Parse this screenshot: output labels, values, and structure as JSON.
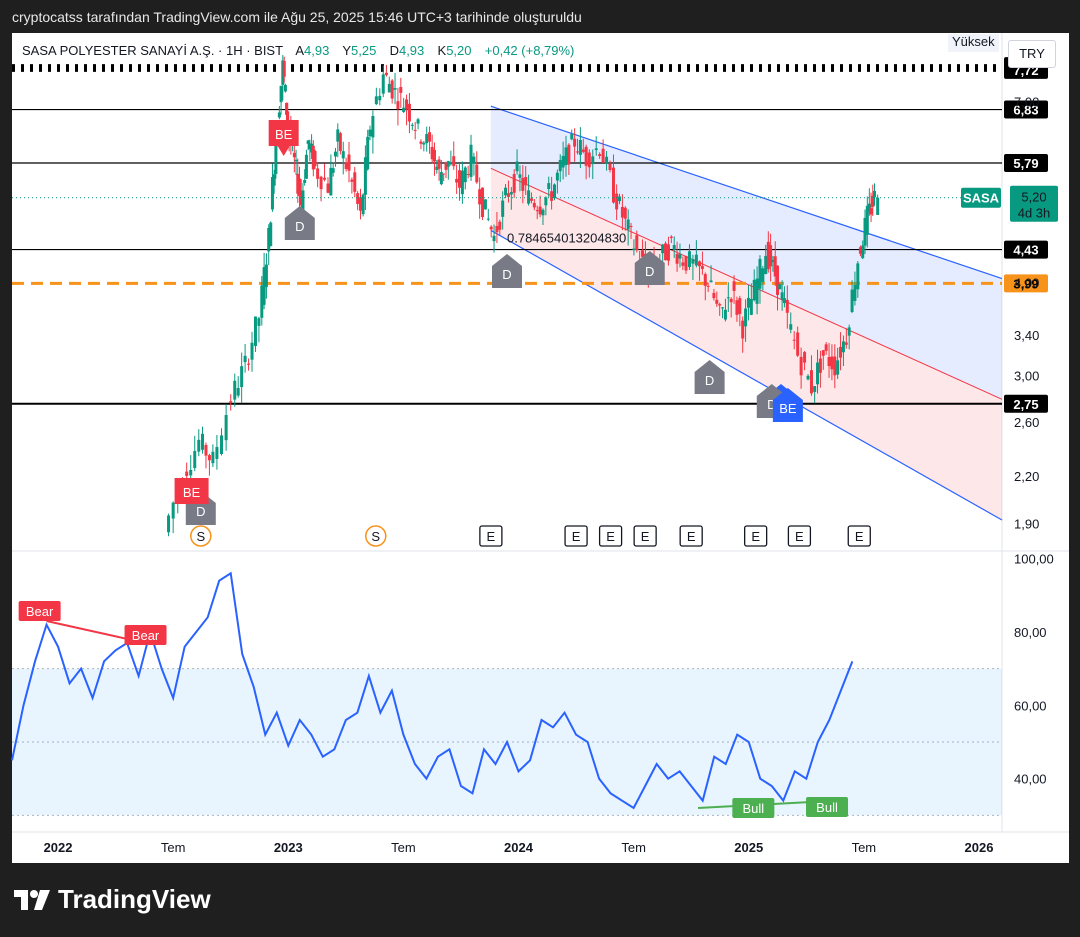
{
  "caption": "cryptocatss tarafından TradingView.com ile Ağu 25, 2025 15:46 UTC+3 tarihinde oluşturuldu",
  "brand": "TradingView",
  "legend": {
    "symbol": "SASA POLYESTER SANAYİ A.Ş. · 1H · BIST",
    "open_label": "A",
    "open": "4,93",
    "high_label": "Y",
    "high": "5,25",
    "low_label": "D",
    "low": "4,93",
    "close_label": "K",
    "close": "5,20",
    "change": "+0,42 (+8,79%)"
  },
  "currency": "TRY",
  "scale_mode": "Yüksek",
  "colors": {
    "up": "#089981",
    "down": "#f23645",
    "rsi": "#2962ff",
    "orange": "#f7931a",
    "channel_line": "#2962ff",
    "mid_line": "#f23645"
  },
  "price_tag": {
    "symbol": "SASA",
    "price": "5,20",
    "countdown": "4d 3h"
  },
  "fib_label": "0.784654013204830",
  "events": {
    "split_label": "S",
    "earnings_label": "E",
    "dividend_label": "D",
    "be_label": "BE",
    "bear_label": "Bear",
    "bull_label": "Bull"
  },
  "chart_data": [
    {
      "type": "candlestick",
      "title": "SASA POLYESTER SANAYİ A.Ş. · 1H · BIST",
      "x_axis": {
        "ticks": [
          "2022",
          "Tem",
          "2023",
          "Tem",
          "2024",
          "Tem",
          "2025",
          "Tem",
          "2026"
        ],
        "range": [
          2021.8,
          2026.1
        ]
      },
      "y_axis": {
        "scale": "log",
        "ticks": [
          "1,90",
          "2,20",
          "2,60",
          "3,00",
          "3,40",
          "4,00",
          "7,00"
        ],
        "range": [
          1.75,
          8.6
        ]
      },
      "ohlc_last": {
        "open": 4.93,
        "high": 5.25,
        "low": 4.93,
        "close": 5.2
      },
      "price_path": [
        [
          2022.47,
          1.85
        ],
        [
          2022.55,
          2.2
        ],
        [
          2022.62,
          2.45
        ],
        [
          2022.68,
          2.3
        ],
        [
          2022.76,
          2.8
        ],
        [
          2022.82,
          3.1
        ],
        [
          2022.88,
          3.6
        ],
        [
          2022.92,
          4.6
        ],
        [
          2022.95,
          6.2
        ],
        [
          2022.98,
          7.8
        ],
        [
          2023.0,
          6.5
        ],
        [
          2023.03,
          5.8
        ],
        [
          2023.06,
          5.1
        ],
        [
          2023.09,
          6.2
        ],
        [
          2023.12,
          5.7
        ],
        [
          2023.18,
          5.4
        ],
        [
          2023.22,
          6.2
        ],
        [
          2023.27,
          5.6
        ],
        [
          2023.32,
          4.9
        ],
        [
          2023.36,
          6.5
        ],
        [
          2023.42,
          7.6
        ],
        [
          2023.47,
          7.2
        ],
        [
          2023.52,
          6.9
        ],
        [
          2023.57,
          6.4
        ],
        [
          2023.62,
          6.1
        ],
        [
          2023.66,
          5.6
        ],
        [
          2023.7,
          5.8
        ],
        [
          2023.75,
          5.4
        ],
        [
          2023.8,
          5.9
        ],
        [
          2023.85,
          5.1
        ],
        [
          2023.9,
          4.6
        ],
        [
          2023.95,
          5.2
        ],
        [
          2024.0,
          5.6
        ],
        [
          2024.05,
          5.2
        ],
        [
          2024.1,
          5.1
        ],
        [
          2024.15,
          5.3
        ],
        [
          2024.2,
          5.8
        ],
        [
          2024.25,
          6.2
        ],
        [
          2024.3,
          5.9
        ],
        [
          2024.36,
          6.1
        ],
        [
          2024.42,
          5.3
        ],
        [
          2024.47,
          4.8
        ],
        [
          2024.52,
          4.4
        ],
        [
          2024.57,
          4.1
        ],
        [
          2024.62,
          4.3
        ],
        [
          2024.67,
          4.5
        ],
        [
          2024.72,
          4.3
        ],
        [
          2024.78,
          4.2
        ],
        [
          2024.83,
          4.0
        ],
        [
          2024.88,
          3.6
        ],
        [
          2024.93,
          3.9
        ],
        [
          2024.98,
          3.5
        ],
        [
          2025.03,
          3.9
        ],
        [
          2025.08,
          4.4
        ],
        [
          2025.12,
          4.1
        ],
        [
          2025.16,
          3.7
        ],
        [
          2025.22,
          3.2
        ],
        [
          2025.28,
          2.9
        ],
        [
          2025.33,
          3.2
        ],
        [
          2025.38,
          3.1
        ],
        [
          2025.43,
          3.4
        ],
        [
          2025.48,
          4.3
        ],
        [
          2025.52,
          4.9
        ],
        [
          2025.55,
          5.2
        ]
      ],
      "horizontal_levels": [
        7.81,
        7.72,
        6.83,
        5.79,
        4.43,
        3.99,
        2.75
      ],
      "level_labels": [
        "7,81",
        "7,72",
        "6,83",
        "5,79",
        "4,43",
        "3,99",
        "2,75"
      ],
      "annotations": [
        "BE",
        "D",
        "D",
        "D",
        "D",
        "D",
        "D",
        "BE",
        "BE"
      ]
    },
    {
      "type": "line",
      "title": "",
      "y_axis": {
        "ticks": [
          "40,00",
          "60,00",
          "80,00",
          "100,00"
        ],
        "range": [
          26,
          101
        ]
      },
      "bands": [
        30,
        50,
        70
      ],
      "values": [
        [
          2021.8,
          45
        ],
        [
          2021.85,
          60
        ],
        [
          2021.9,
          72
        ],
        [
          2021.95,
          82
        ],
        [
          2022.0,
          76
        ],
        [
          2022.05,
          66
        ],
        [
          2022.1,
          70
        ],
        [
          2022.15,
          62
        ],
        [
          2022.2,
          72
        ],
        [
          2022.25,
          75
        ],
        [
          2022.3,
          77
        ],
        [
          2022.35,
          68
        ],
        [
          2022.4,
          80
        ],
        [
          2022.45,
          70
        ],
        [
          2022.5,
          62
        ],
        [
          2022.55,
          76
        ],
        [
          2022.6,
          80
        ],
        [
          2022.65,
          84
        ],
        [
          2022.7,
          94
        ],
        [
          2022.75,
          96
        ],
        [
          2022.8,
          74
        ],
        [
          2022.85,
          65
        ],
        [
          2022.9,
          52
        ],
        [
          2022.95,
          58
        ],
        [
          2023.0,
          49
        ],
        [
          2023.05,
          56
        ],
        [
          2023.1,
          52
        ],
        [
          2023.15,
          46
        ],
        [
          2023.2,
          48
        ],
        [
          2023.25,
          56
        ],
        [
          2023.3,
          58
        ],
        [
          2023.35,
          68
        ],
        [
          2023.4,
          58
        ],
        [
          2023.45,
          64
        ],
        [
          2023.5,
          52
        ],
        [
          2023.55,
          44
        ],
        [
          2023.6,
          40
        ],
        [
          2023.65,
          46
        ],
        [
          2023.7,
          48
        ],
        [
          2023.75,
          38
        ],
        [
          2023.8,
          36
        ],
        [
          2023.85,
          48
        ],
        [
          2023.9,
          44
        ],
        [
          2023.95,
          50
        ],
        [
          2024.0,
          42
        ],
        [
          2024.05,
          45
        ],
        [
          2024.1,
          56
        ],
        [
          2024.15,
          54
        ],
        [
          2024.2,
          58
        ],
        [
          2024.25,
          52
        ],
        [
          2024.3,
          50
        ],
        [
          2024.35,
          40
        ],
        [
          2024.4,
          36
        ],
        [
          2024.45,
          34
        ],
        [
          2024.5,
          32
        ],
        [
          2024.55,
          38
        ],
        [
          2024.6,
          44
        ],
        [
          2024.65,
          40
        ],
        [
          2024.7,
          42
        ],
        [
          2024.75,
          38
        ],
        [
          2024.8,
          34
        ],
        [
          2024.85,
          46
        ],
        [
          2024.9,
          44
        ],
        [
          2024.95,
          52
        ],
        [
          2025.0,
          50
        ],
        [
          2025.05,
          40
        ],
        [
          2025.1,
          38
        ],
        [
          2025.15,
          34
        ],
        [
          2025.2,
          42
        ],
        [
          2025.25,
          40
        ],
        [
          2025.3,
          50
        ],
        [
          2025.35,
          56
        ],
        [
          2025.4,
          64
        ],
        [
          2025.45,
          72
        ]
      ],
      "divergences": [
        "Bear",
        "Bull"
      ]
    }
  ]
}
